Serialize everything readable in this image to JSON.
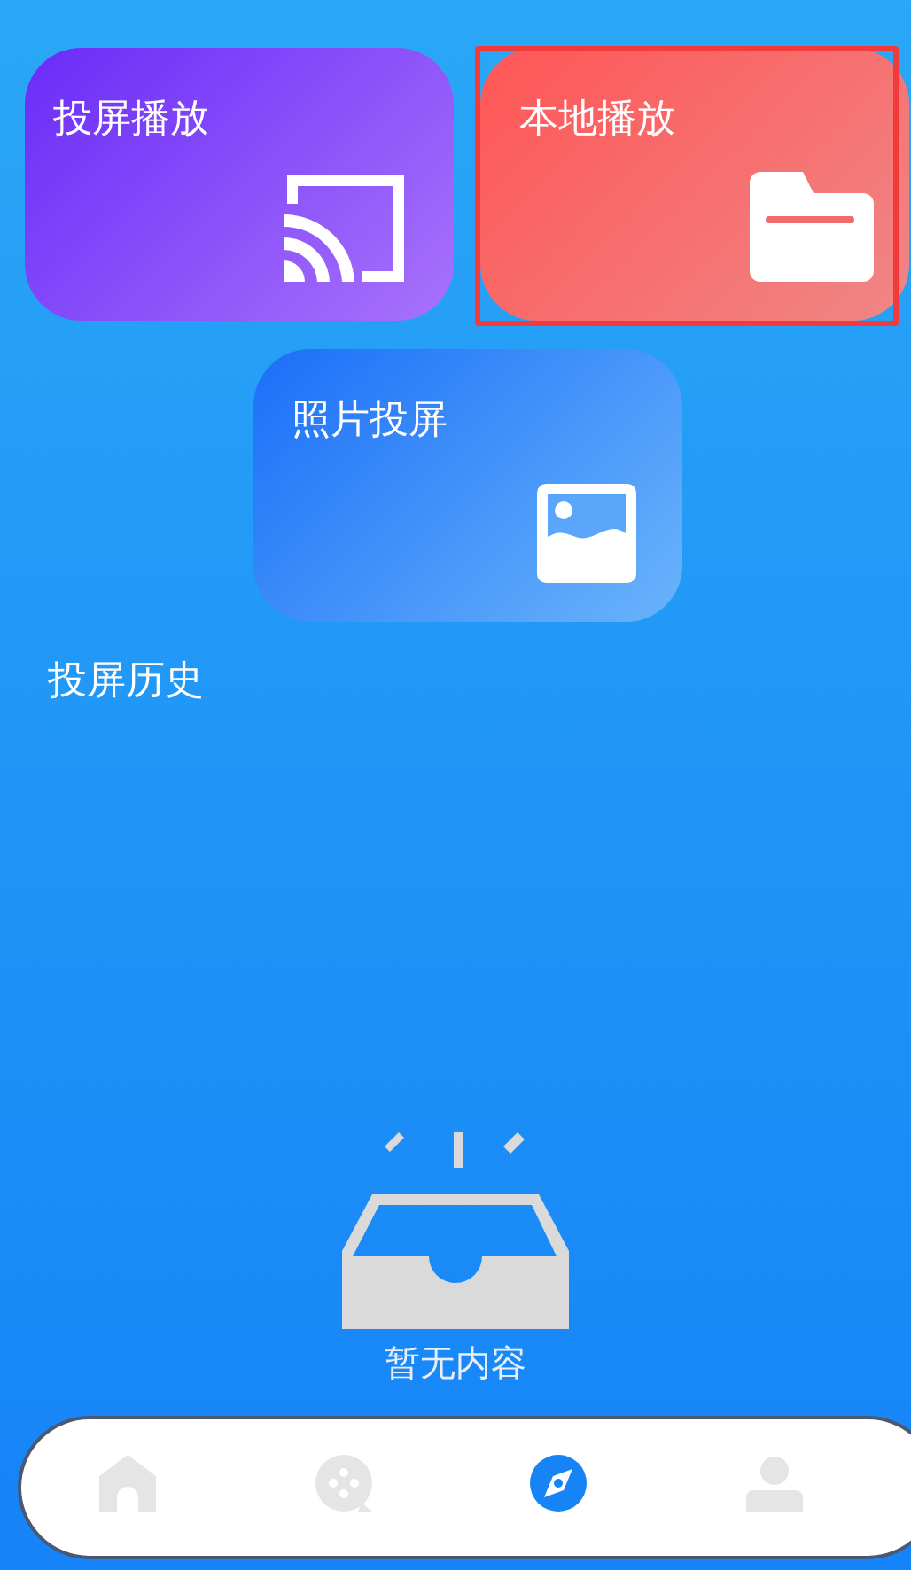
{
  "cards": [
    {
      "title": "投屏播放",
      "kind": "cast",
      "selected": false
    },
    {
      "title": "本地播放",
      "kind": "folder",
      "selected": true
    },
    {
      "title": "照片投屏",
      "kind": "photo",
      "selected": false
    }
  ],
  "history": {
    "title": "投屏历史",
    "empty_text": "暂无内容"
  },
  "tab_bar": [
    {
      "kind": "home",
      "selected": false
    },
    {
      "kind": "film",
      "selected": false
    },
    {
      "kind": "compass",
      "selected": true
    },
    {
      "kind": "profile",
      "selected": false
    }
  ]
}
